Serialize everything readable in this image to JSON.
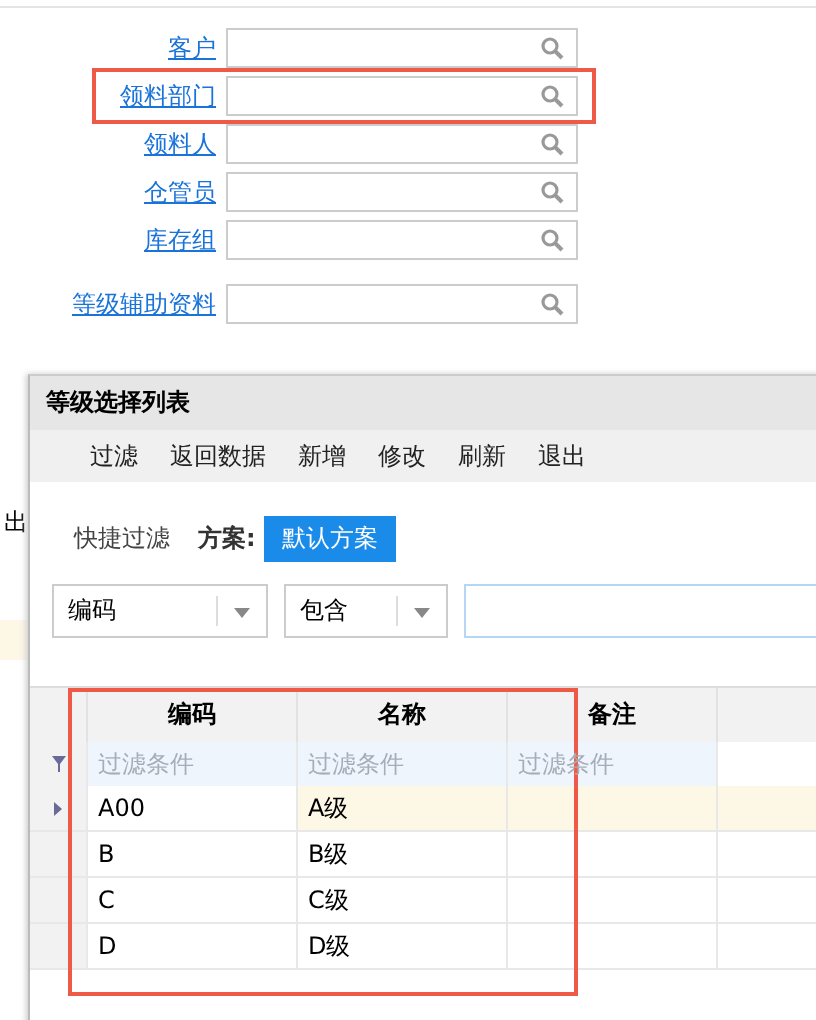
{
  "form": {
    "fields": [
      {
        "label": "客户",
        "highlighted": false
      },
      {
        "label": "领料部门",
        "highlighted": true
      },
      {
        "label": "领料人",
        "highlighted": false
      },
      {
        "label": "仓管员",
        "highlighted": false
      },
      {
        "label": "库存组",
        "highlighted": false
      },
      {
        "label": "等级辅助资料",
        "highlighted": false
      }
    ]
  },
  "background_text": "出",
  "dialog": {
    "title": "等级选择列表",
    "toolbar": [
      "过滤",
      "返回数据",
      "新增",
      "修改",
      "刷新",
      "退出"
    ],
    "quick_filter": {
      "label": "快捷过滤",
      "scheme_label": "方案:",
      "scheme": "默认方案"
    },
    "filter": {
      "field": "编码",
      "operator": "包含"
    },
    "grid": {
      "highlighted": true,
      "columns": [
        "编码",
        "名称",
        "备注"
      ],
      "filter_placeholder": [
        "过滤条件",
        "过滤条件",
        "过滤条件"
      ],
      "rows": [
        {
          "cells": [
            "A00",
            "A级",
            ""
          ],
          "selected": true
        },
        {
          "cells": [
            "B",
            "B级",
            ""
          ],
          "selected": false
        },
        {
          "cells": [
            "C",
            "C级",
            ""
          ],
          "selected": false
        },
        {
          "cells": [
            "D",
            "D级",
            ""
          ],
          "selected": false
        }
      ]
    }
  }
}
